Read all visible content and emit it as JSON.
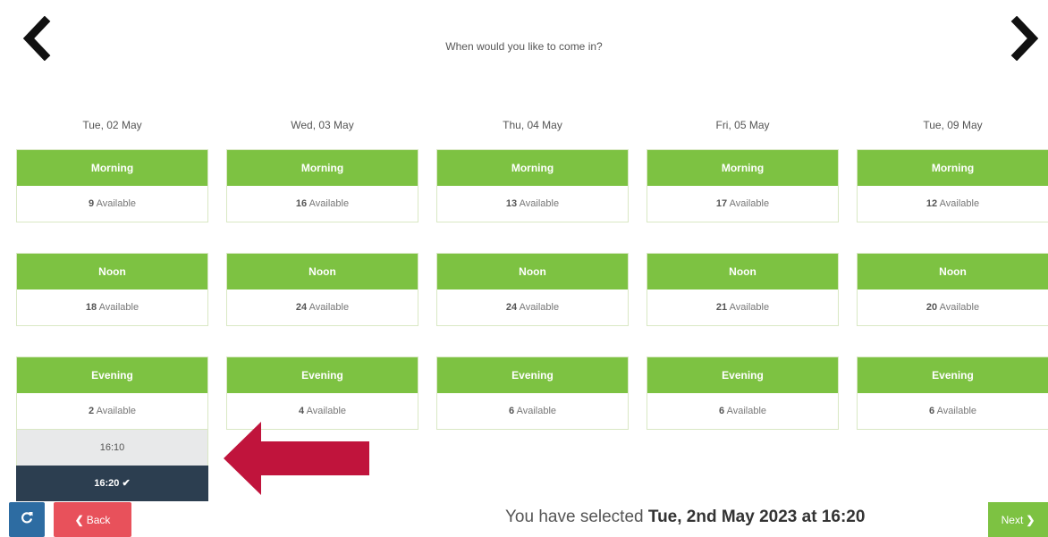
{
  "header": {
    "title": "When would you like to come in?",
    "prev_icon": "chevron-left-icon",
    "next_icon": "chevron-right-icon"
  },
  "days": [
    {
      "date": "Tue, 02 May",
      "morning": {
        "label": "Morning",
        "count": "9",
        "suffix": "Available"
      },
      "noon": {
        "label": "Noon",
        "count": "18",
        "suffix": "Available"
      },
      "evening": {
        "label": "Evening",
        "count": "2",
        "suffix": "Available"
      }
    },
    {
      "date": "Wed, 03 May",
      "morning": {
        "label": "Morning",
        "count": "16",
        "suffix": "Available"
      },
      "noon": {
        "label": "Noon",
        "count": "24",
        "suffix": "Available"
      },
      "evening": {
        "label": "Evening",
        "count": "4",
        "suffix": "Available"
      }
    },
    {
      "date": "Thu, 04 May",
      "morning": {
        "label": "Morning",
        "count": "13",
        "suffix": "Available"
      },
      "noon": {
        "label": "Noon",
        "count": "24",
        "suffix": "Available"
      },
      "evening": {
        "label": "Evening",
        "count": "6",
        "suffix": "Available"
      }
    },
    {
      "date": "Fri, 05 May",
      "morning": {
        "label": "Morning",
        "count": "17",
        "suffix": "Available"
      },
      "noon": {
        "label": "Noon",
        "count": "21",
        "suffix": "Available"
      },
      "evening": {
        "label": "Evening",
        "count": "6",
        "suffix": "Available"
      }
    },
    {
      "date": "Tue, 09 May",
      "morning": {
        "label": "Morning",
        "count": "12",
        "suffix": "Available"
      },
      "noon": {
        "label": "Noon",
        "count": "20",
        "suffix": "Available"
      },
      "evening": {
        "label": "Evening",
        "count": "6",
        "suffix": "Available"
      }
    }
  ],
  "times": [
    {
      "time": "16:10",
      "selected": false
    },
    {
      "time": "16:20",
      "selected": true
    }
  ],
  "footer": {
    "refresh_icon": "refresh-icon",
    "back_label": "Back",
    "summary_prefix": "You have selected",
    "summary_value": "Tue, 2nd May 2023 at 16:20",
    "next_label": "Next"
  },
  "colors": {
    "slot_header": "#7dc242",
    "selected_time": "#2c3e50",
    "back_button": "#e8515b",
    "refresh_button": "#2d6ca2",
    "arrow": "#c0143c"
  }
}
